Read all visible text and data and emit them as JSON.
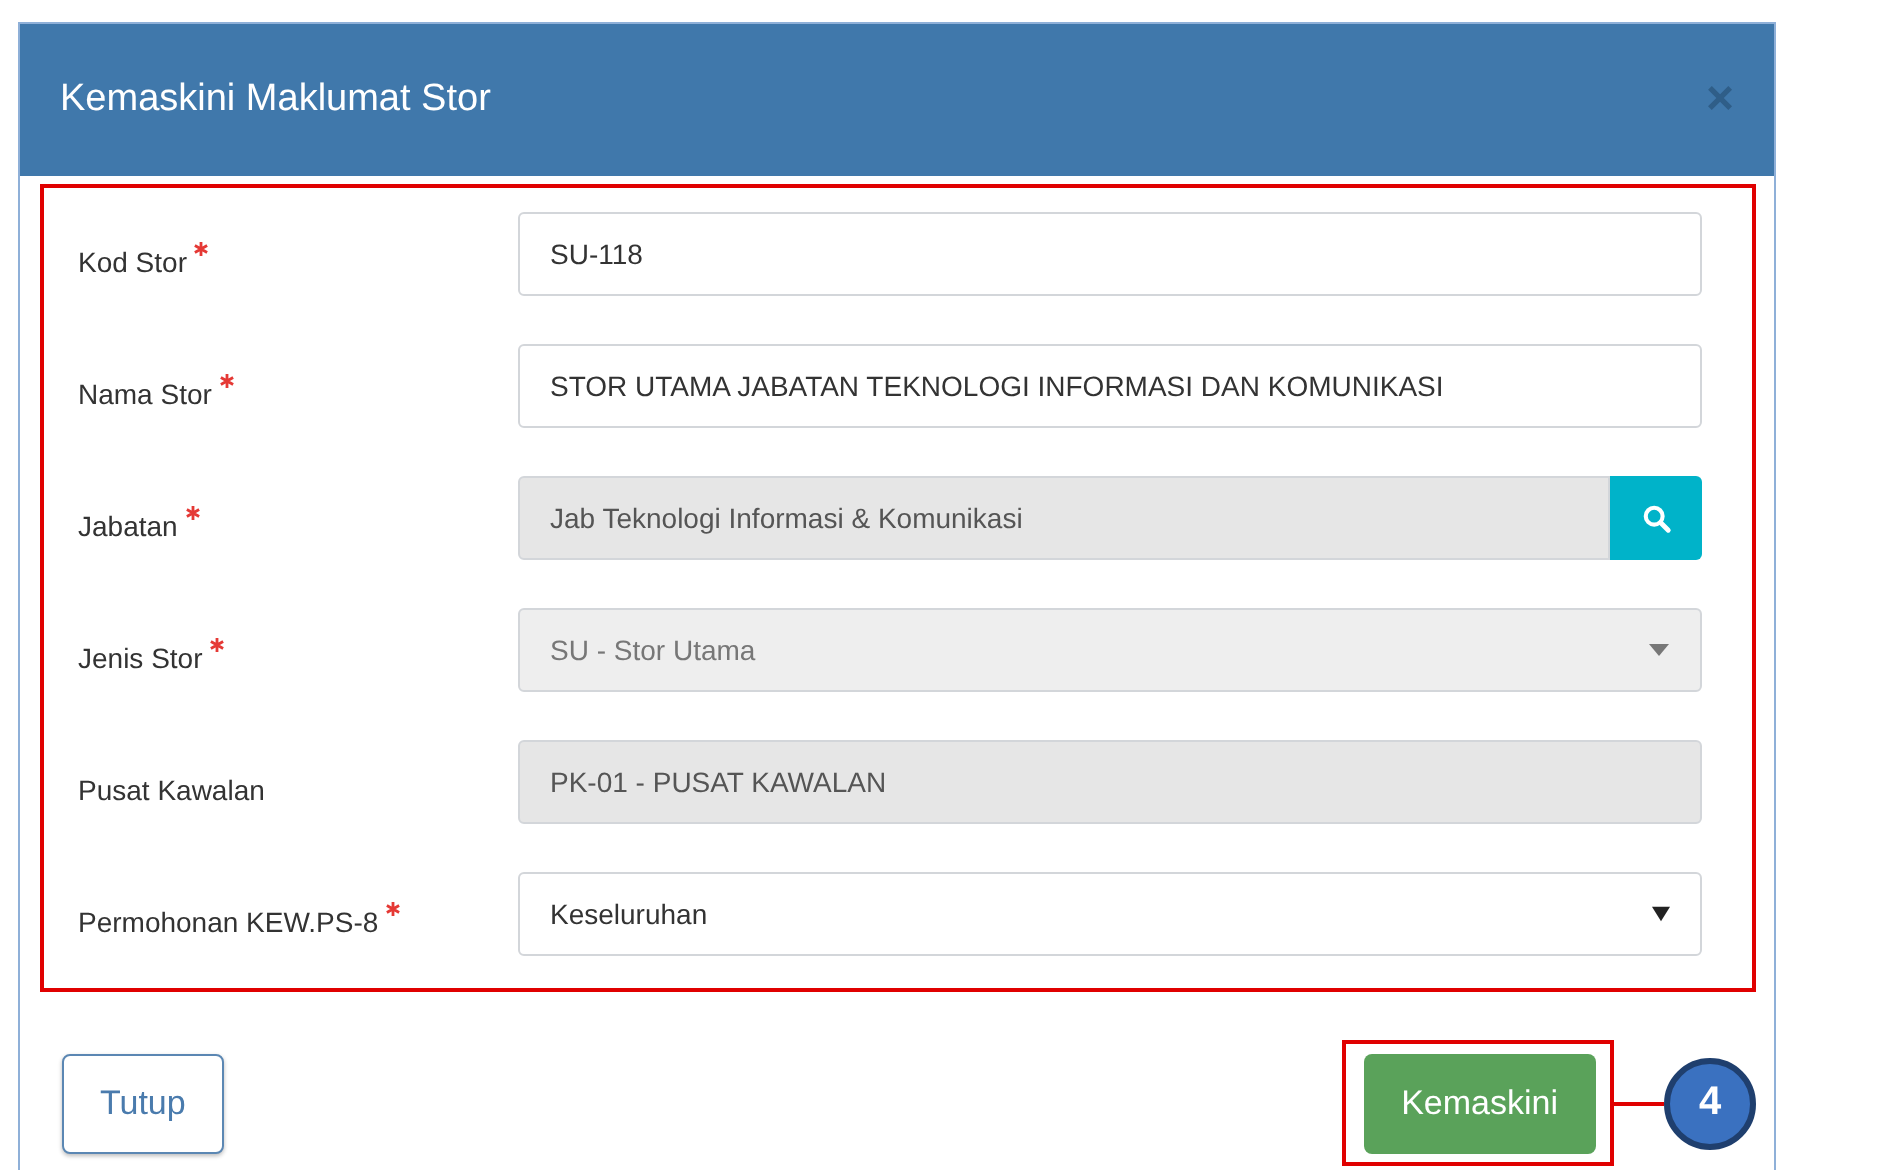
{
  "dialog": {
    "title": "Kemaskini Maklumat Stor",
    "close": "×"
  },
  "form": {
    "highlighted": true,
    "fields": [
      {
        "label": "Kod Stor",
        "required": true,
        "kind": "text",
        "value": "SU-118",
        "disabled": false
      },
      {
        "label": "Nama Stor",
        "required": true,
        "kind": "text",
        "value": "STOR UTAMA JABATAN TEKNOLOGI INFORMASI DAN KOMUNIKASI",
        "disabled": false
      },
      {
        "label": "Jabatan",
        "required": true,
        "kind": "lookup",
        "value": "Jab Teknologi Informasi & Komunikasi",
        "disabled": true
      },
      {
        "label": "Jenis Stor",
        "required": true,
        "kind": "select",
        "value": "SU - Stor Utama",
        "disabled": true
      },
      {
        "label": "Pusat Kawalan",
        "required": false,
        "kind": "text",
        "value": "PK-01 - PUSAT KAWALAN",
        "disabled": true
      },
      {
        "label": "Permohonan KEW.PS-8",
        "required": true,
        "kind": "native-select",
        "value": "Keseluruhan",
        "disabled": false
      }
    ]
  },
  "buttons": [
    {
      "label": "Tutup",
      "kind": "secondary"
    },
    {
      "label": "Kemaskini",
      "kind": "primary",
      "highlighted": true
    }
  ],
  "callout": {
    "label": "4"
  }
}
